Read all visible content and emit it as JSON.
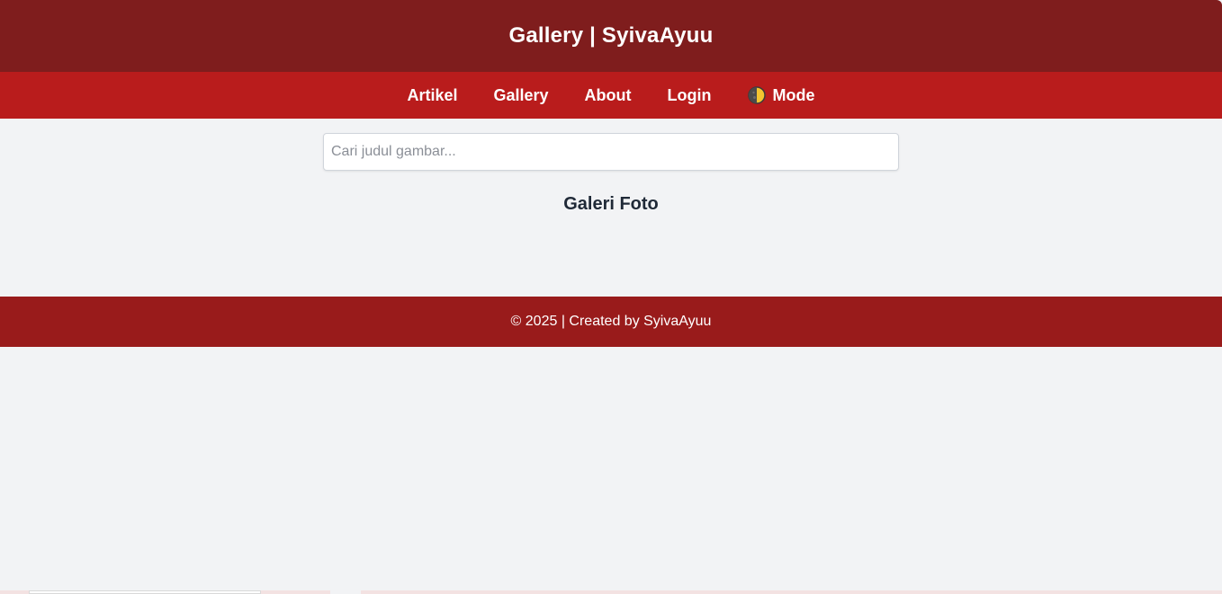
{
  "header": {
    "title": "Gallery | SyivaAyuu"
  },
  "nav": {
    "items": [
      {
        "label": "Artikel"
      },
      {
        "label": "Gallery"
      },
      {
        "label": "About"
      },
      {
        "label": "Login"
      }
    ],
    "mode_toggle": {
      "label": "Mode",
      "icon": "half-moon-icon"
    }
  },
  "search": {
    "placeholder": "Cari judul gambar...",
    "value": ""
  },
  "main": {
    "section_title": "Galeri Foto"
  },
  "footer": {
    "text": "© 2025 | Created by SyivaAyuu"
  },
  "colors": {
    "header_bg": "#7f1d1d",
    "nav_bg": "#b91c1c",
    "footer_bg": "#991b1b",
    "page_bg": "#f2f3f5"
  }
}
